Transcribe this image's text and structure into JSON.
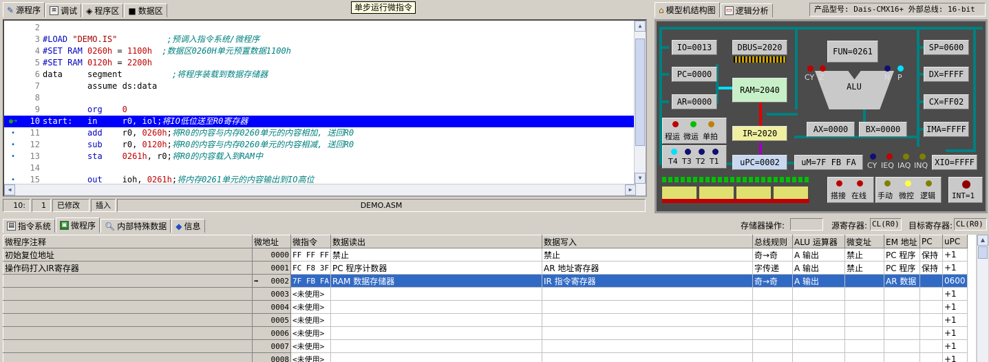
{
  "top_tabs": [
    "源程序",
    "调试",
    "程序区",
    "数据区"
  ],
  "hint_tooltip": "单步运行微指令",
  "right_tabs": [
    "模型机结构图",
    "逻辑分析"
  ],
  "product_info": "产品型号: Dais-CMX16+  外部总线: 16-bit",
  "editor": {
    "lines": [
      {
        "n": "2",
        "mark": "",
        "html": ""
      },
      {
        "n": "3",
        "mark": "",
        "html": "<span class='kw'>#LOAD</span> <span class='st'>\"DEMO.IS\"</span>          <span class='cm'>;预调入指令系统/微程序</span>"
      },
      {
        "n": "4",
        "mark": "",
        "html": "<span class='kw'>#SET RAM</span> <span class='nm'>0260h</span> = <span class='nm'>1100h</span>  <span class='cm'>;数据区0260H单元预置数据1100h</span>"
      },
      {
        "n": "5",
        "mark": "",
        "html": "<span class='kw'>#SET RAM</span> <span class='nm'>0120h</span> = <span class='nm'>2200h</span>"
      },
      {
        "n": "6",
        "mark": "",
        "html": "data     segment          <span class='cm'>;将程序装载到数据存储器</span>"
      },
      {
        "n": "7",
        "mark": "",
        "html": "         assume ds:data"
      },
      {
        "n": "8",
        "mark": "",
        "html": ""
      },
      {
        "n": "9",
        "mark": "",
        "html": "         <span class='kw'>org</span>    <span class='nm'>0</span>"
      },
      {
        "n": "10",
        "mark": "arrow",
        "html": "start:   <span class='kw'>in</span>     r0, iol;<span class='cm'>将IO低位送至R0寄存器</span>"
      },
      {
        "n": "11",
        "mark": "dot",
        "html": "         <span class='kw'>add</span>    r0, <span class='nm'>0260h</span>;<span class='cm'>将R0的内容与内存0260单元的内容相加, 送回R0</span>"
      },
      {
        "n": "12",
        "mark": "dot",
        "html": "         <span class='kw'>sub</span>    r0, <span class='nm'>0120h</span>;<span class='cm'>将R0的内容与内存0260单元的内容相减, 送回R0</span>"
      },
      {
        "n": "13",
        "mark": "dot",
        "html": "         <span class='kw'>sta</span>    <span class='nm'>0261h</span>, r0;<span class='cm'>将R0的内容载入到RAM中</span>"
      },
      {
        "n": "14",
        "mark": "",
        "html": ""
      },
      {
        "n": "15",
        "mark": "dot",
        "html": "         <span class='kw'>out</span>    ioh, <span class='nm'>0261h</span>;<span class='cm'>将内存0261单元的内容输出到IO高位</span>"
      }
    ]
  },
  "status": {
    "pos": "10:",
    "col": "1",
    "modified": "已修改",
    "mode": "插入",
    "file": "DEMO.ASM"
  },
  "model": {
    "io": "IO=0013",
    "dbus": "DBUS=2020",
    "pc": "PC=0000",
    "ar": "AR=0000",
    "ram": "RAM=2040",
    "ir": "IR=2020",
    "upc": "uPC=0002",
    "um": "uM=7F FB FA",
    "fun": "FUN=0261",
    "alu": "ALU",
    "ax": "AX=0000",
    "bx": "BX=0000",
    "sp": "SP=0600",
    "dx": "DX=FFFF",
    "cx": "CX=FF02",
    "ima": "IMA=FFFF",
    "xio": "XIO=FFFF",
    "flags_left": [
      "CY",
      "Z"
    ],
    "flags_right": [
      "N",
      "P"
    ],
    "run_labels": [
      "程运",
      "微运",
      "单拍"
    ],
    "t_labels": [
      "T4",
      "T3",
      "T2",
      "T1"
    ],
    "um_flags": [
      "CY",
      "IEQ",
      "IAQ",
      "INQ"
    ],
    "bottom_labels_a": [
      "搭接",
      "在线"
    ],
    "bottom_labels_b": [
      "手动",
      "微控",
      "逻辑"
    ],
    "int": "INT=1"
  },
  "lower_tabs": [
    "指令系统",
    "微程序",
    "内部特殊数据",
    "信息"
  ],
  "storage_op_label": "存储器操作:",
  "src_reg_label": "源寄存器:",
  "src_reg_value": "CL(R0)",
  "dst_reg_label": "目标寄存器:",
  "dst_reg_value": "CL(R0)",
  "grid": {
    "headers": [
      "微程序注释",
      "微地址",
      "微指令",
      "数据读出",
      "数据写入",
      "总线规则",
      "ALU 运算器",
      "微变址",
      "EM 地址",
      "PC",
      "uPC"
    ],
    "rows": [
      [
        "初始复位地址",
        "0000",
        "FF FF FF",
        "禁止",
        "禁止",
        "奇→奇",
        "A 输出",
        "禁止",
        "PC 程序",
        "保持",
        "+1"
      ],
      [
        "操作码打入IR寄存器",
        "0001",
        "FC F8 3F",
        "PC 程序计数器",
        "AR 地址寄存器",
        "字传递",
        "A 输出",
        "禁止",
        "PC 程序",
        "保持",
        "+1"
      ],
      [
        "",
        "0002",
        "7F FB FA",
        "RAM 数据存储器",
        "IR 指令寄存器",
        "奇→奇",
        "A 输出",
        "",
        "AR 数据",
        "",
        "0600"
      ],
      [
        "",
        "0003",
        "<未使用>",
        "",
        "",
        "",
        "",
        "",
        "",
        "",
        "+1"
      ],
      [
        "",
        "0004",
        "<未使用>",
        "",
        "",
        "",
        "",
        "",
        "",
        "",
        "+1"
      ],
      [
        "",
        "0005",
        "<未使用>",
        "",
        "",
        "",
        "",
        "",
        "",
        "",
        "+1"
      ],
      [
        "",
        "0006",
        "<未使用>",
        "",
        "",
        "",
        "",
        "",
        "",
        "",
        "+1"
      ],
      [
        "",
        "0007",
        "<未使用>",
        "",
        "",
        "",
        "",
        "",
        "",
        "",
        "+1"
      ],
      [
        "",
        "0008",
        "<未使用>",
        "",
        "",
        "",
        "",
        "",
        "",
        "",
        "+1"
      ]
    ],
    "current_row": 2
  }
}
